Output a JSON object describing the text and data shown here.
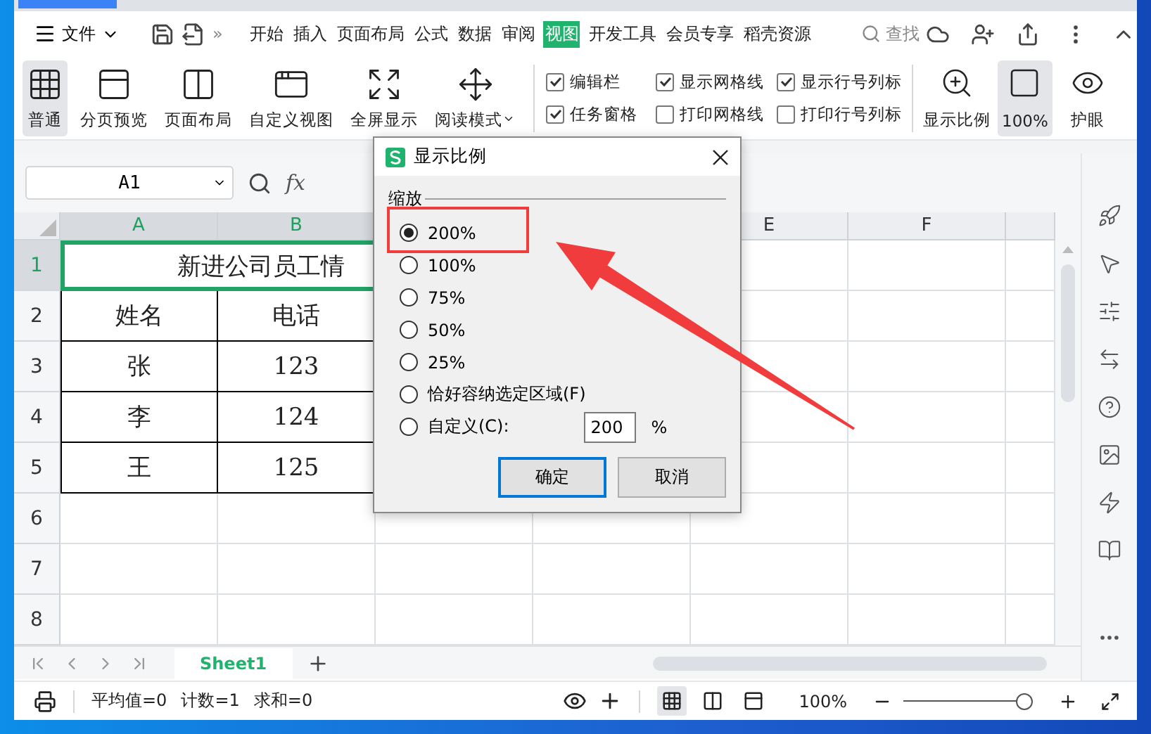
{
  "menu": {
    "file": "文件",
    "more": "»",
    "search": "查找",
    "tabs": [
      {
        "label": "开始",
        "selected": false
      },
      {
        "label": "插入",
        "selected": false
      },
      {
        "label": "页面布局",
        "selected": false
      },
      {
        "label": "公式",
        "selected": false
      },
      {
        "label": "数据",
        "selected": false
      },
      {
        "label": "审阅",
        "selected": false
      },
      {
        "label": "视图",
        "selected": true
      },
      {
        "label": "开发工具",
        "selected": false
      },
      {
        "label": "会员专享",
        "selected": false
      },
      {
        "label": "稻壳资源",
        "selected": false
      }
    ]
  },
  "ribbon": {
    "views": [
      {
        "label": "普通",
        "selected": true
      },
      {
        "label": "分页预览",
        "selected": false
      },
      {
        "label": "页面布局",
        "selected": false
      },
      {
        "label": "自定义视图",
        "selected": false
      },
      {
        "label": "全屏显示",
        "selected": false
      },
      {
        "label": "阅读模式",
        "selected": false,
        "dropdown": true
      }
    ],
    "options": [
      {
        "label": "编辑栏",
        "checked": true
      },
      {
        "label": "显示网格线",
        "checked": true
      },
      {
        "label": "显示行号列标",
        "checked": true
      },
      {
        "label": "任务窗格",
        "checked": true
      },
      {
        "label": "打印网格线",
        "checked": false
      },
      {
        "label": "打印行号列标",
        "checked": false
      }
    ],
    "zoom": [
      {
        "label": "显示比例",
        "selected": false
      },
      {
        "label": "100%",
        "selected": true
      },
      {
        "label": "护眼",
        "selected": false
      }
    ]
  },
  "formula_bar": {
    "cell": "A1",
    "fx": "fx"
  },
  "sheet": {
    "columns": [
      {
        "label": "A",
        "selected": true
      },
      {
        "label": "B",
        "selected": true
      },
      {
        "label": "E",
        "selected": false
      },
      {
        "label": "F",
        "selected": false
      }
    ],
    "title": "新进公司员工情",
    "rows": [
      {
        "header": "1",
        "selected": true
      },
      {
        "header": "2",
        "selected": false,
        "cells": [
          "姓名",
          "电话"
        ]
      },
      {
        "header": "3",
        "selected": false,
        "cells": [
          "张",
          "123"
        ]
      },
      {
        "header": "4",
        "selected": false,
        "cells": [
          "李",
          "124"
        ]
      },
      {
        "header": "5",
        "selected": false,
        "cells": [
          "王",
          "125"
        ]
      },
      {
        "header": "6",
        "selected": false
      },
      {
        "header": "7",
        "selected": false
      },
      {
        "header": "8",
        "selected": false
      }
    ]
  },
  "sheet_tabs": [
    {
      "label": "Sheet1",
      "selected": true
    }
  ],
  "status_bar": {
    "stats": [
      "平均值=0",
      "计数=1",
      "求和=0"
    ],
    "zoom": "100%",
    "zoom_slider": {
      "level": 0.95
    }
  },
  "dialog": {
    "title": "显示比例",
    "group": "缩放",
    "options": [
      {
        "label": "200%",
        "selected": true
      },
      {
        "label": "100%",
        "selected": false
      },
      {
        "label": "75%",
        "selected": false
      },
      {
        "label": "50%",
        "selected": false
      },
      {
        "label": "25%",
        "selected": false
      },
      {
        "label": "恰好容纳选定区域(F)",
        "selected": false
      },
      {
        "label": "自定义(C):",
        "selected": false,
        "value": "200",
        "unit": "%"
      }
    ],
    "buttons": [
      {
        "label": "确定",
        "default": true
      },
      {
        "label": "取消",
        "default": false
      }
    ]
  },
  "annotations": {
    "highlight_box": true,
    "arrow": true
  }
}
